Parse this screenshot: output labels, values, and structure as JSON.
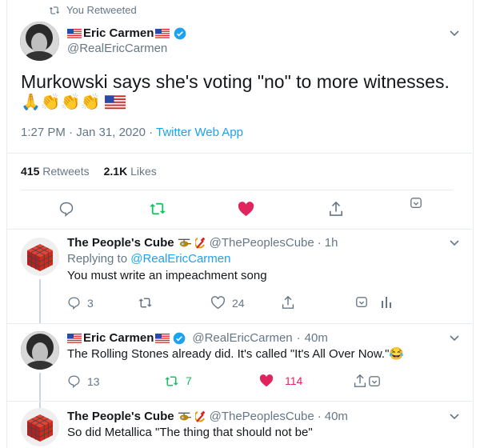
{
  "retweet_notice": {
    "text": "You Retweeted"
  },
  "main_tweet": {
    "author_name": "Eric Carmen",
    "handle": "@RealEricCarmen",
    "text": "Murkowski says she's voting \"no\" to more witnesses.",
    "emoji_line": "🙏👏👏👏",
    "timestamp": "1:27 PM · Jan 31, 2020",
    "source": "Twitter Web App",
    "retweets_count": "415",
    "retweets_label": "Retweets",
    "likes_count": "2.1K",
    "likes_label": "Likes"
  },
  "reply1": {
    "author_name": "The People's Cube",
    "handle": "@ThePeoplesCube",
    "time": "1h",
    "replying_prefix": "Replying to",
    "replying_to": "@RealEricCarmen",
    "text": "You must write an impeachment song",
    "reply_count": "3",
    "like_count": "24"
  },
  "reply2": {
    "author_name": "Eric Carmen",
    "handle": "@RealEricCarmen",
    "time": "40m",
    "text": "The Rolling Stones already did. It's called \"It's All Over Now.\"😂",
    "reply_count": "13",
    "retweet_count": "7",
    "like_count": "114"
  },
  "reply3": {
    "author_name": "The People's Cube",
    "handle": "@ThePeoplesCube",
    "time": "40m",
    "text": "So did Metallica \"The thing that should not be\""
  },
  "colors": {
    "accent": "#1da1f2",
    "retweet_green": "#17bf63",
    "like_red": "#e0245e",
    "muted": "#657786"
  }
}
